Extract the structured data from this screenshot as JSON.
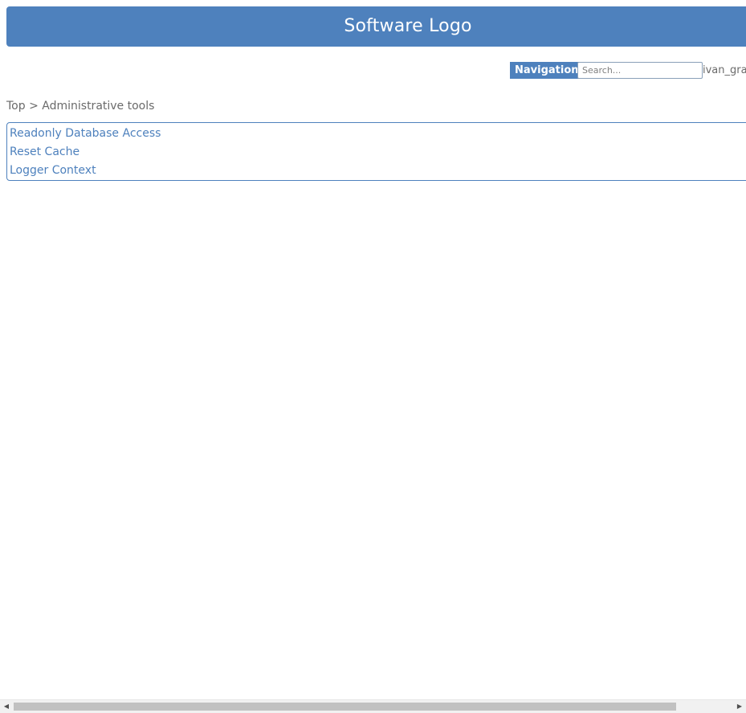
{
  "header": {
    "logo_text": "Software Logo"
  },
  "topbar": {
    "navigation_label": "Navigation",
    "search_placeholder": "Search...",
    "search_value": "",
    "username": "ivan_gra"
  },
  "breadcrumb": {
    "top_label": "Top",
    "separator": ">",
    "current_label": "Administrative tools"
  },
  "menu": {
    "items": [
      {
        "label": "Readonly Database Access"
      },
      {
        "label": "Reset Cache"
      },
      {
        "label": "Logger Context"
      }
    ]
  },
  "scrollbar": {
    "left_arrow": "◀",
    "right_arrow": "▶"
  },
  "colors": {
    "accent": "#4e81bd",
    "text_muted": "#6a6a6a",
    "background": "#ffffff"
  }
}
